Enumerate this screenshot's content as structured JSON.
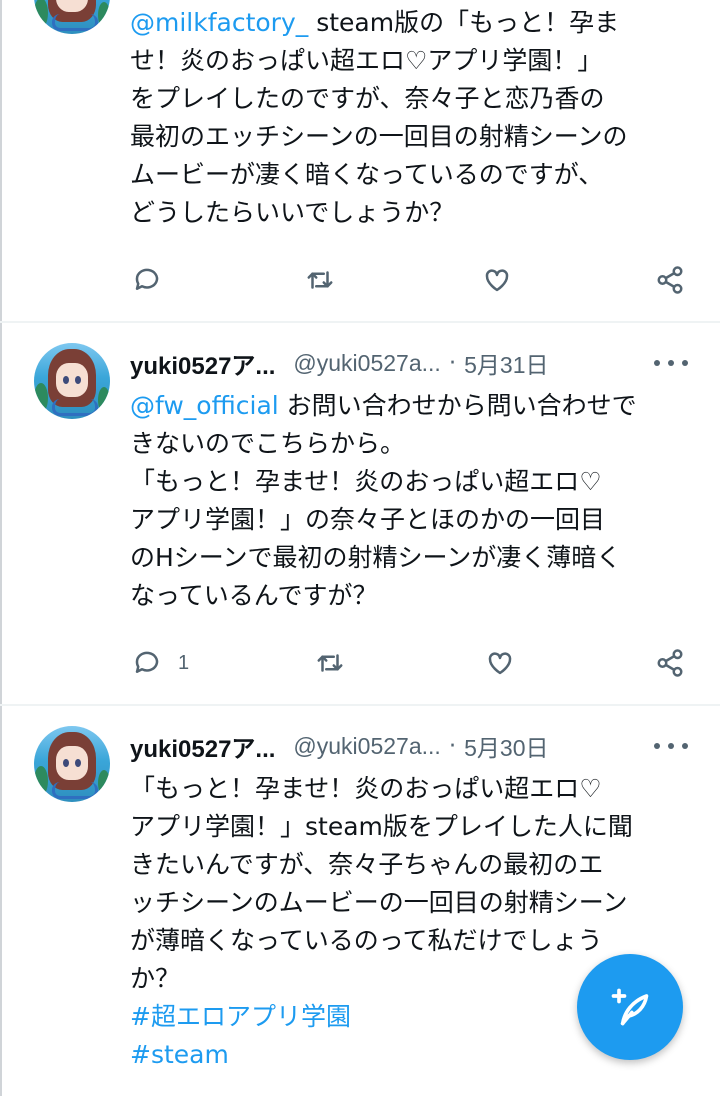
{
  "tweets": [
    {
      "body_lines": [
        {
          "mention": "@milkfactory_",
          "text": " steam版の「もっと！孕ま"
        },
        {
          "text": "せ！炎のおっぱい超エロ♡アプリ学園！」"
        },
        {
          "text": "をプレイしたのですが、奈々子と恋乃香の"
        },
        {
          "text": "最初のエッチシーンの一回目の射精シーンの"
        },
        {
          "text": "ムービーが凄く暗くなっているのですが、"
        },
        {
          "text": "どうしたらいいでしょうか？"
        }
      ],
      "reply_count": ""
    },
    {
      "name": "yuki0527ア...",
      "handle": "@yuki0527a...",
      "dot": "·",
      "date": "5月31日",
      "body_lines": [
        {
          "mention": "@fw_official",
          "text": " お問い合わせから問い合わせで"
        },
        {
          "text": "きないのでこちらから。"
        },
        {
          "text": "「もっと！孕ませ！炎のおっぱい超エロ♡"
        },
        {
          "text": "アプリ学園！」の奈々子とほのかの一回目"
        },
        {
          "text": "のHシーンで最初の射精シーンが凄く薄暗く"
        },
        {
          "text": "なっているんですが？"
        }
      ],
      "reply_count": "1"
    },
    {
      "name": "yuki0527ア...",
      "handle": "@yuki0527a...",
      "dot": "·",
      "date": "5月30日",
      "body_lines": [
        {
          "text": "「もっと！孕ませ！炎のおっぱい超エロ♡"
        },
        {
          "text": "アプリ学園！」steam版をプレイした人に聞"
        },
        {
          "text": "きたいんですが、奈々子ちゃんの最初のエ"
        },
        {
          "text": "ッチシーンのムービーの一回目の射精シーン"
        },
        {
          "text": "が薄暗くなっているのって私だけでしょう"
        },
        {
          "text": "か？"
        }
      ],
      "hashtags": [
        "#超エロアプリ学園",
        "#steam"
      ]
    }
  ],
  "icons": {
    "reply": "reply-icon",
    "retweet": "retweet-icon",
    "like": "heart-icon",
    "share": "share-icon",
    "more": "more-icon",
    "compose": "compose-tweet-icon"
  },
  "colors": {
    "accent": "#1d9bf0",
    "secondary_text": "#536471",
    "text": "#0f1419"
  }
}
